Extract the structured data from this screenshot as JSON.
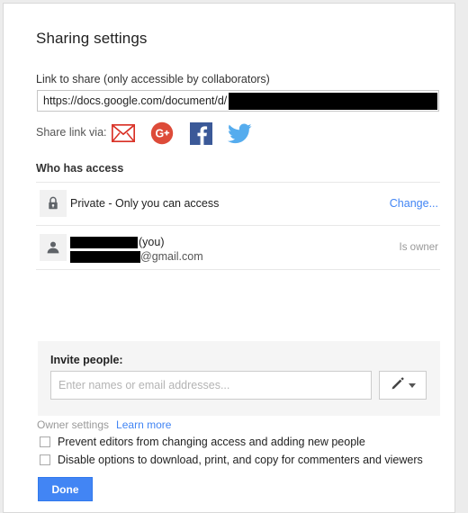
{
  "dialog": {
    "title": "Sharing settings"
  },
  "link_section": {
    "label": "Link to share (only accessible by collaborators)",
    "url_value": "https://docs.google.com/document/d/",
    "url_redacted": true,
    "share_via_label": "Share link via:",
    "social": [
      {
        "name": "gmail-icon",
        "label": "Gmail",
        "color": "#d93025"
      },
      {
        "name": "google-plus-icon",
        "label": "Google Plus",
        "color": "#dd4b39"
      },
      {
        "name": "facebook-icon",
        "label": "Facebook",
        "color": "#3b5998"
      },
      {
        "name": "twitter-icon",
        "label": "Twitter",
        "color": "#55acee"
      }
    ]
  },
  "access_section": {
    "heading": "Who has access",
    "privacy_row": {
      "icon": "lock-icon",
      "text": "Private - Only you can access",
      "action_label": "Change..."
    },
    "owner_row": {
      "icon": "person-icon",
      "name_suffix": "(you)",
      "email_suffix": "@gmail.com",
      "role_label": "Is owner",
      "name_redacted": true,
      "email_redacted": true
    }
  },
  "invite_section": {
    "label": "Invite people:",
    "input_value": "",
    "input_placeholder": "Enter names or email addresses...",
    "permission_button": "pencil-icon"
  },
  "owner_settings": {
    "label": "Owner settings",
    "learn_more": "Learn more",
    "options": [
      {
        "label": "Prevent editors from changing access and adding new people",
        "checked": false
      },
      {
        "label": "Disable options to download, print, and copy for commenters and viewers",
        "checked": false
      }
    ]
  },
  "footer": {
    "done_label": "Done",
    "done_color": "#4285f4"
  }
}
